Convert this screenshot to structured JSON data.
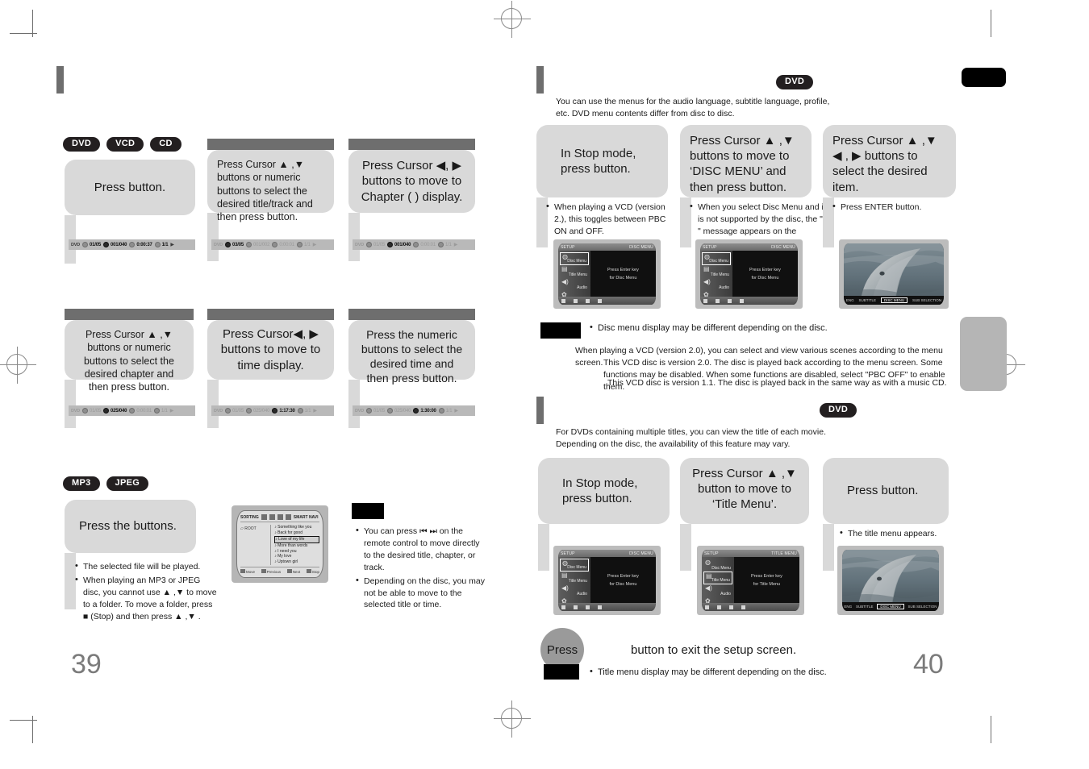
{
  "left_page": {
    "page_number": "39",
    "disc_tags_top": [
      "DVD",
      "VCD",
      "CD"
    ],
    "disc_tags_mp3": [
      "MP3",
      "JPEG"
    ],
    "row1": [
      {
        "text": "Press            button.",
        "osd": {
          "disc": "DVD",
          "title": "01/05",
          "chapter": "001/040",
          "time": "0:00:37",
          "audio": "1/1",
          "hot": "none"
        }
      },
      {
        "text": "Press Cursor ▲ ,▼  buttons or numeric buttons to select the desired title/track and then press          button.",
        "osd": {
          "disc": "DVD",
          "title": "03/05",
          "chapter": "001/002",
          "time": "0:00:01",
          "audio": "1/1",
          "hot": "title"
        }
      },
      {
        "text": "Press Cursor ◀, ▶ buttons to move to Chapter (  ) display.",
        "osd": {
          "disc": "DVD",
          "title": "01/05",
          "chapter": "001/040",
          "time": "0:00:01",
          "audio": "1/1",
          "hot": "chapter"
        }
      }
    ],
    "row2": [
      {
        "text": "Press Cursor ▲ ,▼ buttons or numeric buttons to select the desired chapter and then press          button.",
        "osd": {
          "disc": "DVD",
          "title": "01/05",
          "chapter": "025/040",
          "time": "0:00:01",
          "audio": "1/1",
          "hot": "chapter"
        }
      },
      {
        "text": "Press Cursor◀, ▶ buttons to move to time display.",
        "osd": {
          "disc": "DVD",
          "title": "01/05",
          "chapter": "025/040",
          "time": "1:17:30",
          "audio": "1/1",
          "hot": "time"
        }
      },
      {
        "text": "Press the numeric buttons to select the desired time and then press           button.",
        "osd": {
          "disc": "DVD",
          "title": "01/05",
          "chapter": "025/040",
          "time": "1:30:00",
          "audio": "1/1",
          "hot": "time"
        }
      }
    ],
    "mp3_step": {
      "text": "Press the buttons.",
      "notes": [
        "The selected file will be played.",
        "When playing an MP3 or JPEG disc, you cannot use ▲ ,▼  to move to a folder. To move a folder, press ■ (Stop) and then press ▲ ,▼ ."
      ]
    },
    "mp3_screen": {
      "header_label": "SORTING",
      "smart_nav": "SMART NAVI",
      "root_label": "ROOT",
      "tracks": [
        "Something like you",
        "Back for good",
        "Love of my life",
        "More than words",
        "I need you",
        "My love",
        "Uptown girl"
      ],
      "selected_track_index": 2,
      "footer": [
        "Move",
        "Previous",
        "Next",
        "Stop"
      ]
    },
    "mp3_notes": [
      "You can press ⏮ ⏭  on the remote control to move directly to the desired title, chapter, or track.",
      "Depending on the disc, you may not be able to move to the selected title or time."
    ]
  },
  "right_page": {
    "page_number": "40",
    "section_disc_menu": {
      "disc_tag": "DVD",
      "intro": "You can use the menus for the audio language, subtitle language, profile, etc. DVD menu contents differ from disc to disc.",
      "steps": [
        {
          "text": "In Stop mode, press button.",
          "note": "When playing a VCD (version 2.), this toggles between PBC ON and OFF."
        },
        {
          "text": "Press Cursor  ▲ ,▼ buttons to move to ‘DISC MENU’ and then press            button.",
          "note": "When you select Disc Menu and it is not supported by the disc, the \"                    \" message appears on the screen."
        },
        {
          "text": "Press Cursor ▲ ,▼ ◀ , ▶  buttons to select the desired item.",
          "note": "Press ENTER button."
        }
      ],
      "screens": [
        {
          "type": "setup-menu",
          "title_right": "DISC MENU",
          "title_left": "SETUP",
          "items": [
            "Disc Menu",
            "Title Menu",
            "Audio",
            "Setup"
          ],
          "selected_index": 0,
          "body_lines": [
            "Press Enter key",
            "for Disc Menu"
          ]
        },
        {
          "type": "setup-menu",
          "title_right": "DISC MENU",
          "title_left": "SETUP",
          "items": [
            "Disc Menu",
            "Title Menu",
            "Audio",
            "Setup"
          ],
          "selected_index": 0,
          "body_lines": [
            "Press Enter key",
            "for Disc Menu"
          ]
        },
        {
          "type": "dolphin",
          "bar_items": [
            "ENG",
            "SUBTITLE",
            "DISC MENU",
            "SUB SELECTION"
          ],
          "selected_index": 2
        }
      ],
      "note": "Disc menu display may be different depending on the disc.",
      "vcd_paragraphs": [
        "When playing a VCD (version 2.0), you can select and view various scenes according to the menu screen.",
        "This VCD disc is version 2.0. The disc is played back according to the menu screen. Some functions may be disabled. When some functions are disabled, select \"PBC OFF\" to enable them.",
        "This VCD disc is version 1.1. The disc is played back in the same way as with a music CD."
      ]
    },
    "section_title_menu": {
      "disc_tag": "DVD",
      "intro": "For DVDs containing multiple titles, you can view the title of each movie. Depending on the disc, the availability of this feature may vary.",
      "steps": [
        {
          "text": "In Stop mode, press button.",
          "note": ""
        },
        {
          "text": "Press Cursor ▲ ,▼ button to move to ‘Title Menu’.",
          "note": ""
        },
        {
          "text": "Press button.",
          "note": "The title menu appears."
        }
      ],
      "screens": [
        {
          "type": "setup-menu",
          "title_right": "DISC MENU",
          "title_left": "SETUP",
          "items": [
            "Disc Menu",
            "Title Menu",
            "Audio",
            "Setup"
          ],
          "selected_index": 0,
          "body_lines": [
            "Press Enter key",
            "for Disc Menu"
          ]
        },
        {
          "type": "setup-menu",
          "title_right": "TITLE MENU",
          "title_left": "SETUP",
          "items": [
            "Disc Menu",
            "Title Menu",
            "Audio",
            "Setup"
          ],
          "selected_index": 1,
          "body_lines": [
            "Press Enter key",
            "for Title Menu"
          ]
        },
        {
          "type": "dolphin",
          "bar_items": [
            "ENG",
            "SUBTITLE",
            "DISC MENU",
            "SUB SELECTION"
          ],
          "selected_index": 2
        }
      ],
      "exit_line_prefix": "Press",
      "exit_line_suffix": "button to exit the setup screen.",
      "note": "Title menu display may be different depending on the disc."
    }
  }
}
